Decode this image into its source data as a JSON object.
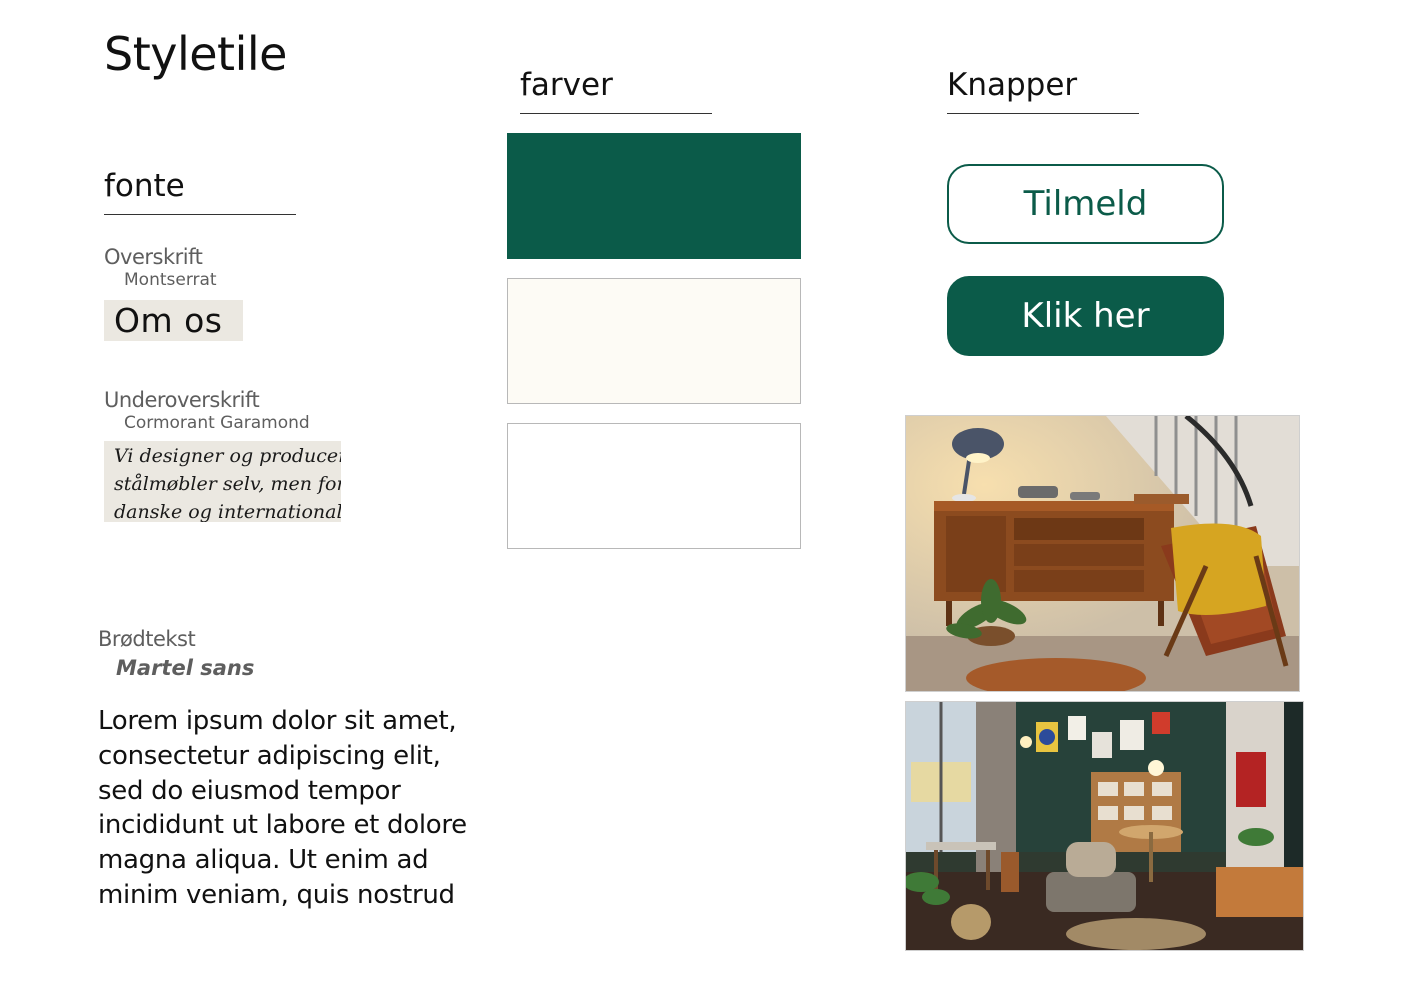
{
  "page": {
    "title": "Styletile"
  },
  "fonts": {
    "heading": "fonte",
    "overskrift": {
      "label": "Overskrift",
      "font_name": "Montserrat",
      "sample": "Om os"
    },
    "underoverskrift": {
      "label": "Underoverskrift",
      "font_name": "Cormorant Garamond",
      "sample_lines": [
        "Vi designer og producerer i",
        "stålmøbler selv, men forha",
        "danske og internationale b"
      ]
    },
    "brodtekst": {
      "label": "Brødtekst",
      "font_name": "Martel sans",
      "sample_lines": [
        "Lorem ipsum dolor sit amet,",
        "consectetur adipiscing elit,",
        "sed do eiusmod tempor",
        "incididunt ut labore et dolore",
        "magna aliqua. Ut enim ad",
        "minim veniam, quis nostrud"
      ]
    }
  },
  "colors": {
    "heading": "farver",
    "swatches": [
      {
        "hex": "#0b5b49",
        "border": "#0b5b49"
      },
      {
        "hex": "#fdfbf5",
        "border": "#b8b8b8"
      },
      {
        "hex": "#ffffff",
        "border": "#b8b8b8"
      }
    ]
  },
  "buttons": {
    "heading": "Knapper",
    "primary_label": "Tilmeld",
    "secondary_label": "Klik her"
  },
  "images": [
    {
      "name": "living-room-sideboard-photo"
    },
    {
      "name": "shop-interior-photo"
    }
  ]
}
